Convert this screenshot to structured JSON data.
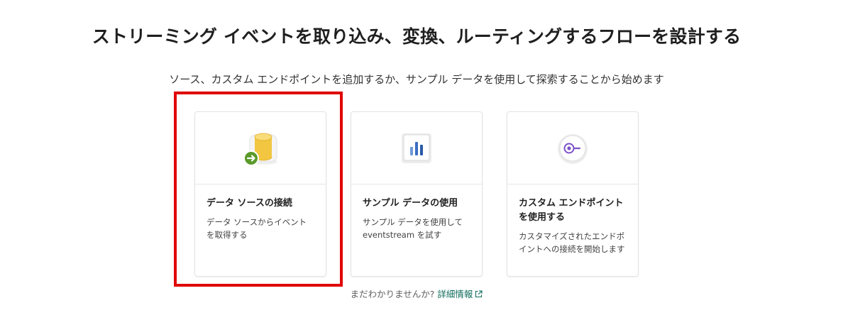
{
  "header": {
    "title": "ストリーミング イベントを取り込み、変換、ルーティングするフローを設計する",
    "subtitle": "ソース、カスタム エンドポイントを追加するか、サンプル データを使用して探索することから始めます"
  },
  "cards": [
    {
      "title": "データ ソースの接続",
      "description": "データ ソースからイベントを取得する",
      "icon": "database-connect-icon",
      "highlighted": true
    },
    {
      "title": "サンプル データの使用",
      "description": "サンプル データを使用して eventstream を試す",
      "icon": "sample-data-chart-icon"
    },
    {
      "title": "カスタム エンドポイントを使用する",
      "description": "カスタマイズされたエンドポイントへの接続を開始します",
      "icon": "custom-endpoint-icon"
    }
  ],
  "help": {
    "question": "まだわかりませんか?",
    "link_label": "詳細情報",
    "link_icon": "external-link-icon"
  },
  "colors": {
    "highlight_border": "#e00000",
    "link": "#0f6c5d",
    "endpoint_accent": "#7b52c7",
    "chart_bars": "#3a6ec4",
    "database_yellow": "#f2c641",
    "arrow_green": "#5a9a2a"
  }
}
